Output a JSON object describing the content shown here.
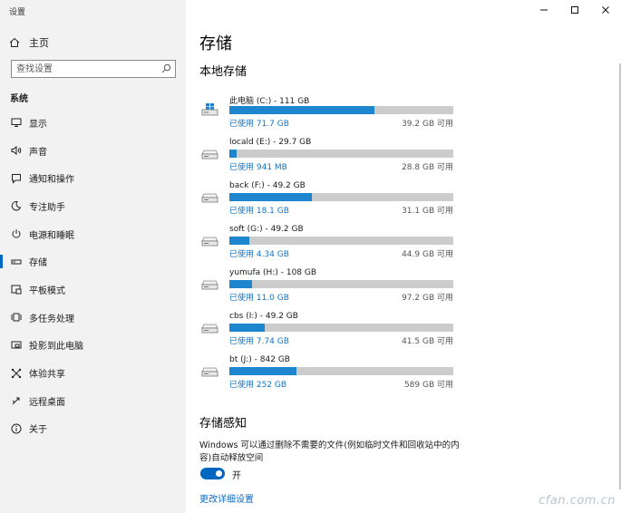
{
  "window": {
    "title": "设置"
  },
  "sidebar": {
    "home_label": "主页",
    "search_placeholder": "查找设置",
    "section_title": "系统",
    "items": [
      {
        "label": "显示",
        "icon": "monitor-icon"
      },
      {
        "label": "声音",
        "icon": "speaker-icon"
      },
      {
        "label": "通知和操作",
        "icon": "notification-icon"
      },
      {
        "label": "专注助手",
        "icon": "moon-icon"
      },
      {
        "label": "电源和睡眠",
        "icon": "power-icon"
      },
      {
        "label": "存储",
        "icon": "storage-icon",
        "active": true
      },
      {
        "label": "平板模式",
        "icon": "tablet-icon"
      },
      {
        "label": "多任务处理",
        "icon": "multitask-icon"
      },
      {
        "label": "投影到此电脑",
        "icon": "project-icon"
      },
      {
        "label": "体验共享",
        "icon": "share-icon"
      },
      {
        "label": "远程桌面",
        "icon": "remote-icon"
      },
      {
        "label": "关于",
        "icon": "info-icon"
      }
    ]
  },
  "main": {
    "title": "存储",
    "local_storage_title": "本地存储",
    "drives": [
      {
        "name": "此电脑 (C:) - 111 GB",
        "used": "已使用 71.7 GB",
        "free": "39.2 GB 可用",
        "used_fraction": 0.646,
        "icon": "windows-drive-icon"
      },
      {
        "name": "locald (E:) - 29.7 GB",
        "used": "已使用 941 MB",
        "free": "28.8 GB 可用",
        "used_fraction": 0.031,
        "icon": "drive-icon"
      },
      {
        "name": "back (F:) - 49.2 GB",
        "used": "已使用 18.1 GB",
        "free": "31.1 GB 可用",
        "used_fraction": 0.368,
        "icon": "drive-icon"
      },
      {
        "name": "soft (G:) - 49.2 GB",
        "used": "已使用 4.34 GB",
        "free": "44.9 GB 可用",
        "used_fraction": 0.088,
        "icon": "drive-icon"
      },
      {
        "name": "yumufa (H:) - 108 GB",
        "used": "已使用 11.0 GB",
        "free": "97.2 GB 可用",
        "used_fraction": 0.102,
        "icon": "drive-icon"
      },
      {
        "name": "cbs (I:) - 49.2 GB",
        "used": "已使用 7.74 GB",
        "free": "41.5 GB 可用",
        "used_fraction": 0.157,
        "icon": "drive-icon"
      },
      {
        "name": "bt (J:) - 842 GB",
        "used": "已使用 252 GB",
        "free": "589 GB 可用",
        "used_fraction": 0.299,
        "icon": "drive-icon"
      }
    ],
    "storage_sense": {
      "title": "存储感知",
      "description": "Windows 可以通过删除不需要的文件(例如临时文件和回收站中的内容)自动释放空间",
      "toggle_label": "开",
      "toggle_on": true,
      "link": "更改详细设置"
    }
  },
  "colors": {
    "accent": "#0067c0",
    "bar_fill": "#1d86cf",
    "bar_track": "#cccccc",
    "sidebar_bg": "#f2f2f2"
  },
  "watermark": "cfan.com.cn"
}
